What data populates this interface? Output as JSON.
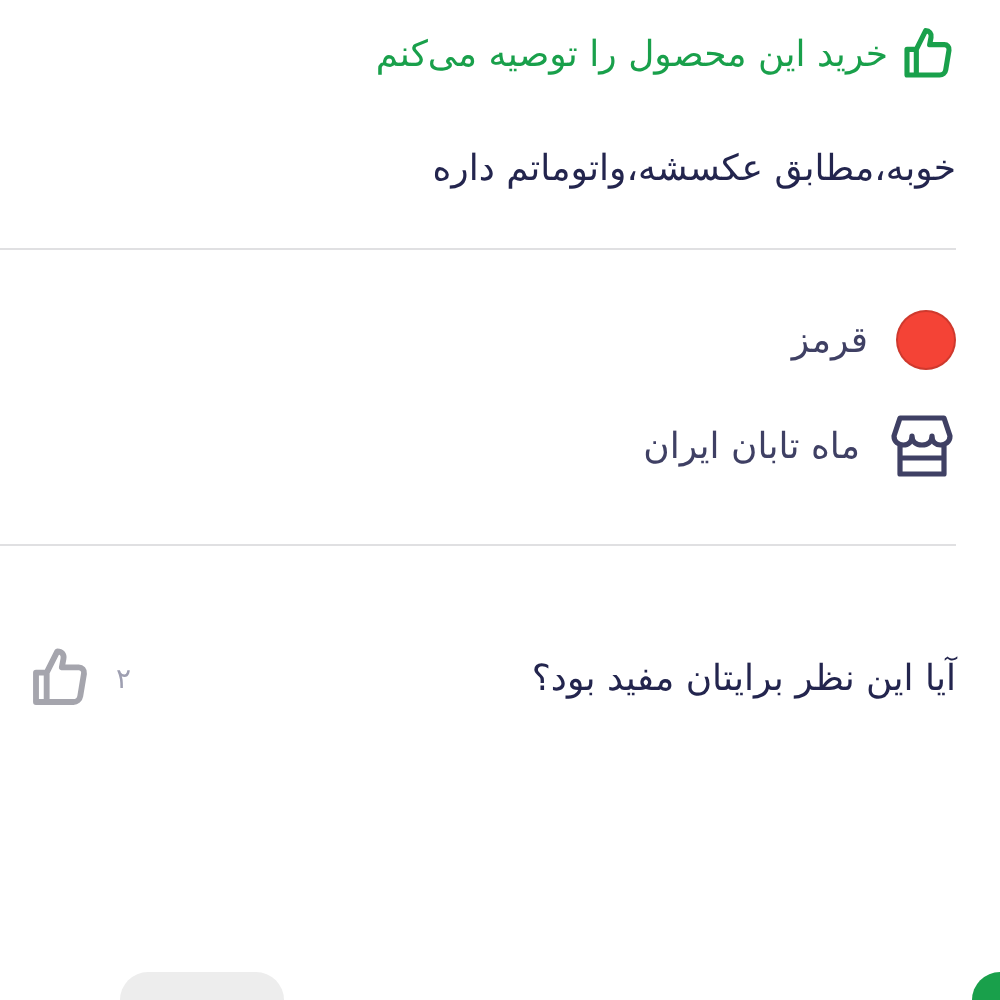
{
  "recommendation": {
    "text": "خرید این محصول را توصیه می‌کنم"
  },
  "comment": "خوبه،مطابق عکسشه،واتوماتم داره",
  "attributes": [
    {
      "kind": "color",
      "label": "قرمز",
      "color": "#f44336"
    },
    {
      "kind": "seller",
      "label": "ماه تابان ایران"
    }
  ],
  "helpful": {
    "question": "آیا این نظر برایتان مفید بود؟",
    "likes": "۲"
  }
}
